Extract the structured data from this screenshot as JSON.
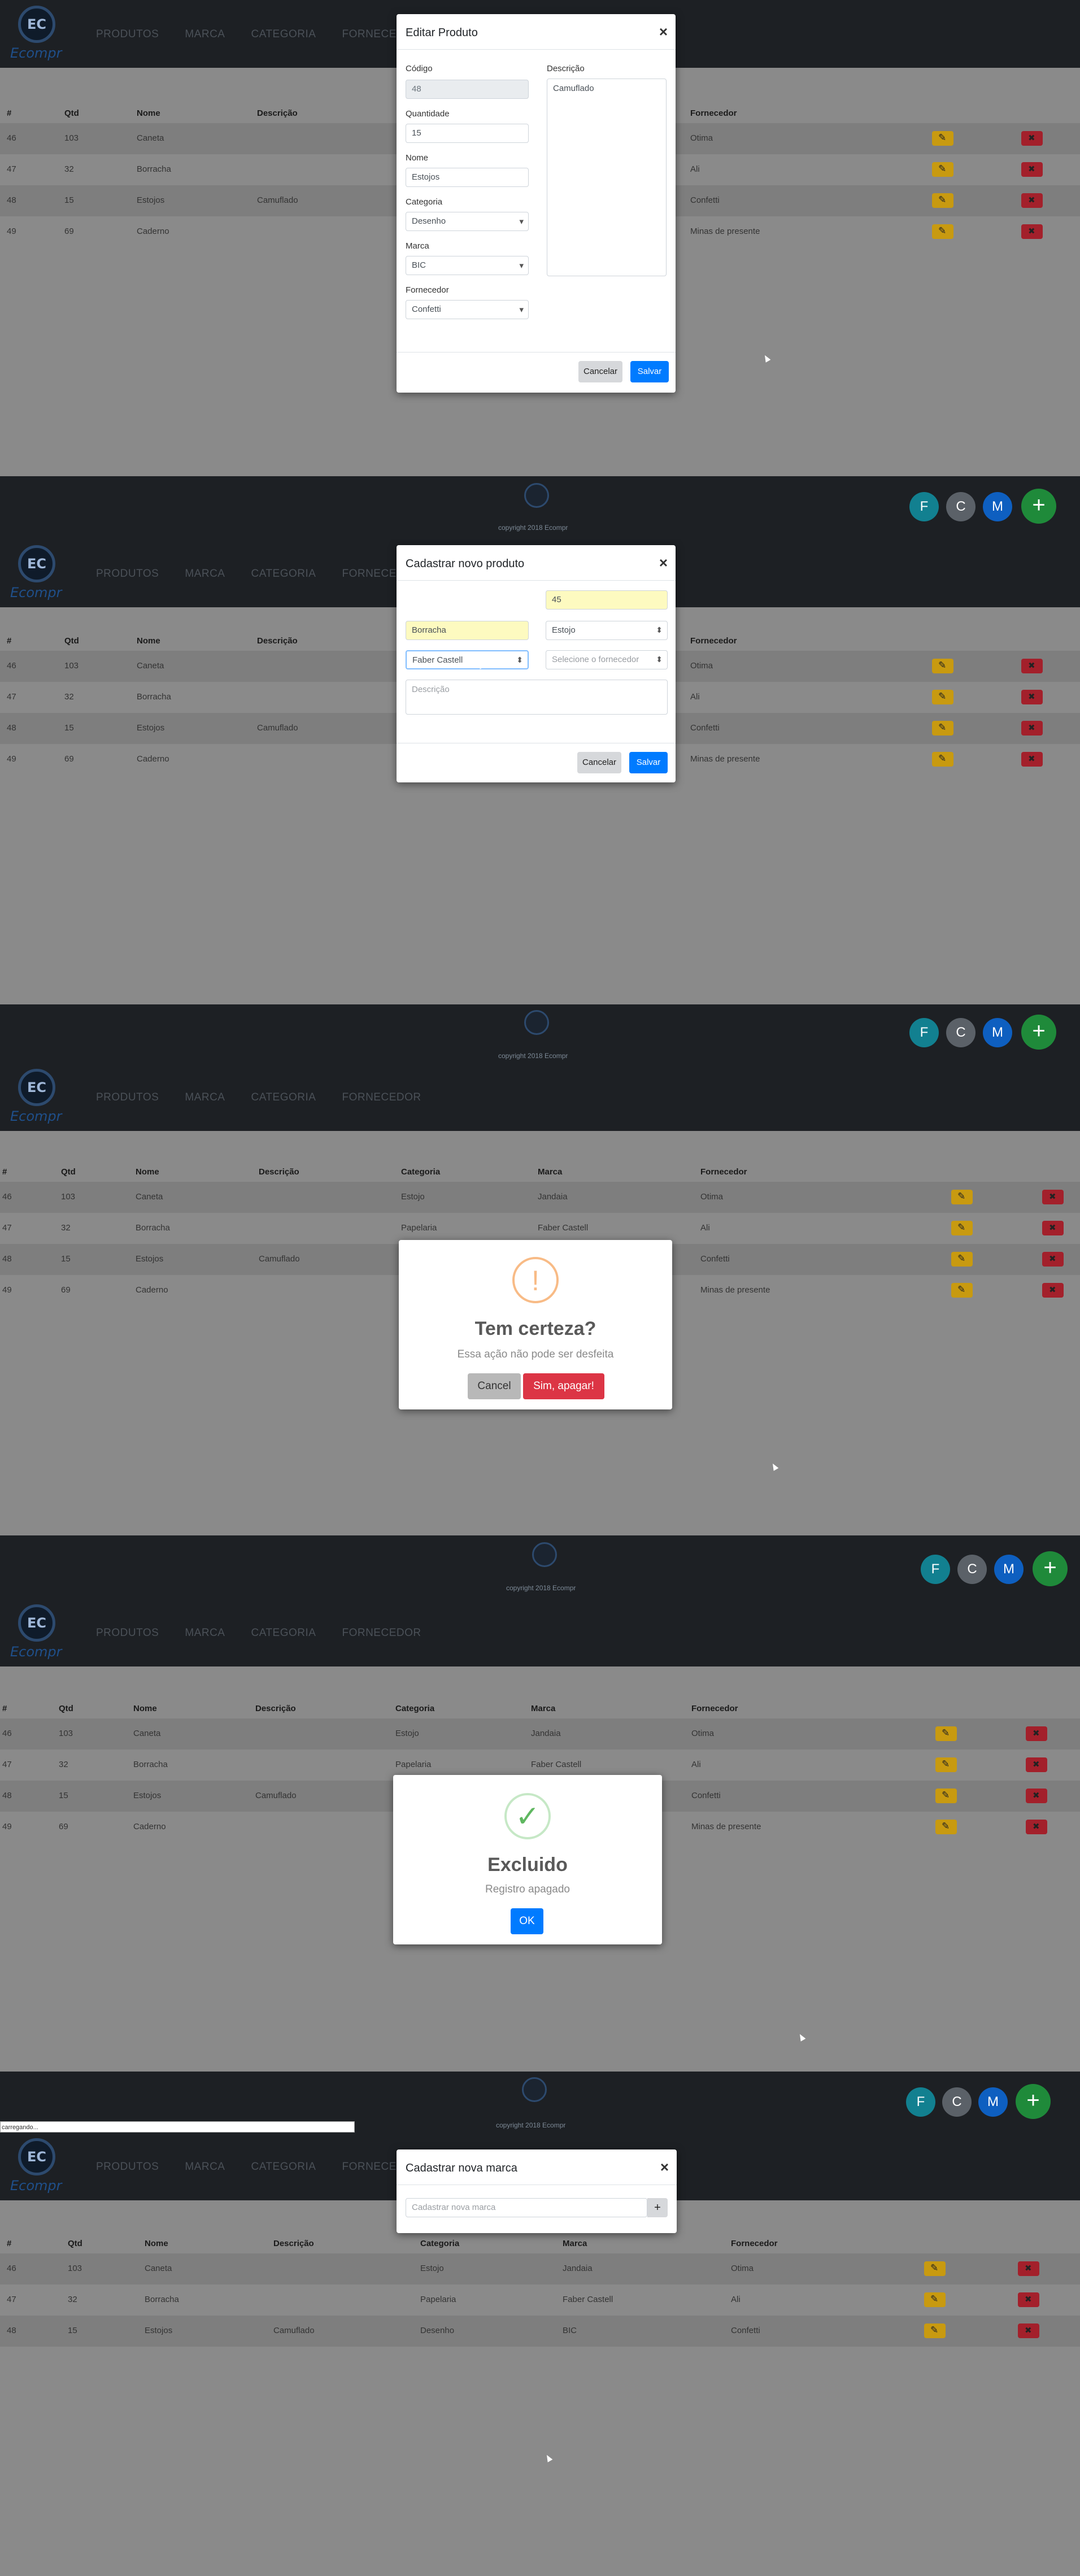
{
  "nav": {
    "brand": "Ecompr",
    "logo_text": "EC",
    "items": [
      "PRODUTOS",
      "MARCA",
      "CATEGORIA",
      "FORNECEDOR"
    ]
  },
  "table": {
    "headers": [
      "#",
      "Qtd",
      "Nome",
      "Descrição",
      "Categoria",
      "Marca",
      "Fornecedor"
    ],
    "rows": [
      {
        "id": "46",
        "qtd": "103",
        "nome": "Caneta",
        "descricao": "",
        "categoria": "Estojo",
        "marca": "Jandaia",
        "fornecedor": "Otima"
      },
      {
        "id": "47",
        "qtd": "32",
        "nome": "Borracha",
        "descricao": "",
        "categoria": "Papelaria",
        "marca": "Faber Castell",
        "fornecedor": "Ali"
      },
      {
        "id": "48",
        "qtd": "15",
        "nome": "Estojos",
        "descricao": "Camuflado",
        "categoria": "Desenho",
        "marca": "BIC",
        "fornecedor": "Confetti"
      },
      {
        "id": "49",
        "qtd": "69",
        "nome": "Caderno",
        "descricao": "",
        "categoria": "",
        "marca": "",
        "fornecedor": "Minas de presente"
      }
    ]
  },
  "footer": {
    "copyright": "copyright 2018 Ecompr"
  },
  "fabs": [
    "F",
    "C",
    "M",
    "+"
  ],
  "edit_modal": {
    "title": "Editar Produto",
    "labels": {
      "codigo": "Código",
      "quantidade": "Quantidade",
      "nome": "Nome",
      "categoria": "Categoria",
      "marca": "Marca",
      "fornecedor": "Fornecedor",
      "descricao": "Descrição"
    },
    "values": {
      "codigo": "48",
      "quantidade": "15",
      "nome": "Estojos",
      "categoria": "Desenho",
      "marca": "BIC",
      "fornecedor": "Confetti",
      "descricao": "Camuflado"
    },
    "cancel": "Cancelar",
    "save": "Salvar"
  },
  "new_product_modal": {
    "title": "Cadastrar novo produto",
    "values": {
      "quantidade": "45",
      "nome": "Borracha",
      "categoria": "Estojo",
      "marca": "Faber Castell"
    },
    "placeholders": {
      "fornecedor": "Selecione o fornecedor",
      "descricao": "Descrição"
    },
    "cancel": "Cancelar",
    "save": "Salvar"
  },
  "confirm_dialog": {
    "title": "Tem certeza?",
    "text": "Essa ação não pode ser desfeita",
    "cancel": "Cancel",
    "confirm": "Sim, apagar!",
    "icon": "!"
  },
  "success_dialog": {
    "title": "Excluido",
    "text": "Registro apagado",
    "ok": "OK",
    "icon": "✓"
  },
  "brand_modal": {
    "title": "Cadastrar nova marca",
    "placeholder": "Cadastrar nova marca",
    "add": "+"
  },
  "loading": {
    "text": "carregando..."
  }
}
